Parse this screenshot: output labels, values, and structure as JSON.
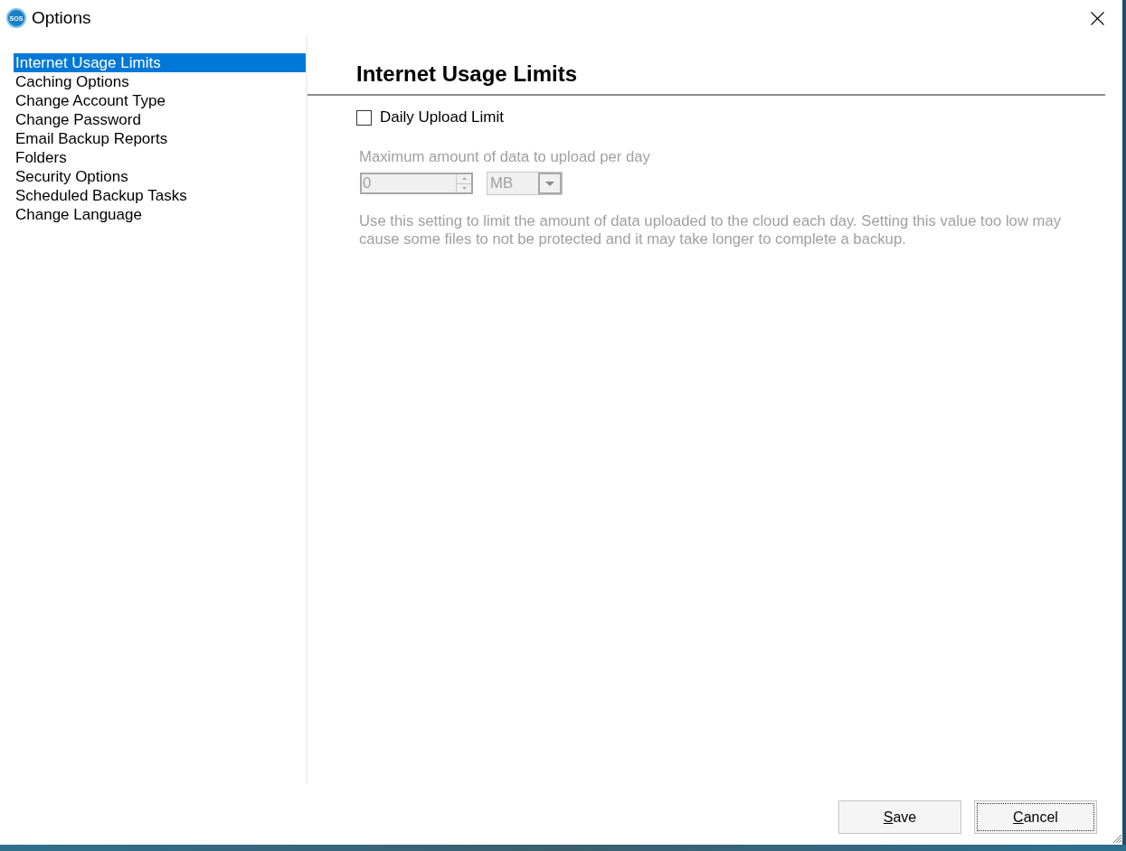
{
  "window": {
    "title": "Options",
    "logo_text": "SOS"
  },
  "sidebar": {
    "items": [
      {
        "label": "Internet Usage Limits",
        "selected": true
      },
      {
        "label": "Caching Options",
        "selected": false
      },
      {
        "label": "Change Account Type",
        "selected": false
      },
      {
        "label": "Change Password",
        "selected": false
      },
      {
        "label": "Email Backup Reports",
        "selected": false
      },
      {
        "label": "Folders",
        "selected": false
      },
      {
        "label": "Security Options",
        "selected": false
      },
      {
        "label": "Scheduled Backup Tasks",
        "selected": false
      },
      {
        "label": "Change Language",
        "selected": false
      }
    ]
  },
  "panel": {
    "heading": "Internet Usage Limits",
    "daily_upload_limit": {
      "label": "Daily Upload Limit",
      "checked": false
    },
    "limit_settings": {
      "disabled": true,
      "label": "Maximum amount of data to upload per day",
      "value": "0",
      "unit": "MB",
      "description": "Use this setting to limit the amount of data uploaded to the cloud each day. Setting this value too low may cause some files to not be protected and it may take longer to complete a backup."
    }
  },
  "buttons": [
    {
      "label": "Save",
      "focused": false
    },
    {
      "label": "Cancel",
      "focused": true
    }
  ]
}
